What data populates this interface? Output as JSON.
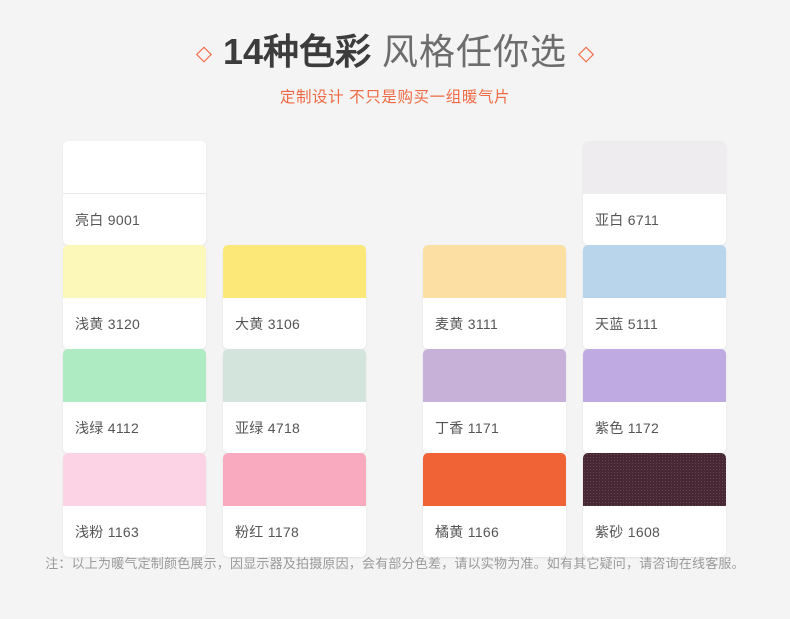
{
  "header": {
    "diamond_left": "◇",
    "diamond_right": "◇",
    "title_strong": "14种色彩",
    "title_light": "风格任你选",
    "subtitle": "定制设计  不只是购买一组暖气片",
    "accent_color": "#ef6a44",
    "title_color": "#3c3c3c"
  },
  "swatches": [
    {
      "name": "亮白 9001",
      "color": "#ffffff",
      "textured": false,
      "needs_divider": true
    },
    {
      "name": "",
      "color": "",
      "empty": true
    },
    {
      "name": "",
      "color": "",
      "empty": true
    },
    {
      "name": "亚白 6711",
      "color": "#eeecef",
      "textured": false,
      "needs_divider": false
    },
    {
      "name": "浅黄 3120",
      "color": "#fbf8b9",
      "textured": false,
      "needs_divider": false
    },
    {
      "name": "大黄 3106",
      "color": "#fbe878",
      "textured": false,
      "needs_divider": false
    },
    {
      "name": "麦黄 3111",
      "color": "#fbdfa3",
      "textured": false,
      "needs_divider": false
    },
    {
      "name": "天蓝 5111",
      "color": "#b9d5ec",
      "textured": false,
      "needs_divider": false
    },
    {
      "name": "浅绿 4112",
      "color": "#aeeac2",
      "textured": false,
      "needs_divider": false
    },
    {
      "name": "亚绿 4718",
      "color": "#d2e4dc",
      "textured": false,
      "needs_divider": false
    },
    {
      "name": "丁香 1171",
      "color": "#c8b1d8",
      "textured": false,
      "needs_divider": false
    },
    {
      "name": "紫色 1172",
      "color": "#bfaae2",
      "textured": false,
      "needs_divider": false
    },
    {
      "name": "浅粉 1163",
      "color": "#fbd3e5",
      "textured": false,
      "needs_divider": false
    },
    {
      "name": "粉红 1178",
      "color": "#f9aabe",
      "textured": false,
      "needs_divider": false
    },
    {
      "name": "橘黄 1166",
      "color": "#ef6337",
      "textured": false,
      "needs_divider": false
    },
    {
      "name": "紫砂 1608",
      "color": "#482834",
      "textured": true,
      "needs_divider": false
    }
  ],
  "note": "注：以上为暖气定制颜色展示，因显示器及拍摄原因，会有部分色差，请以实物为准。如有其它疑问，请咨询在线客服。"
}
